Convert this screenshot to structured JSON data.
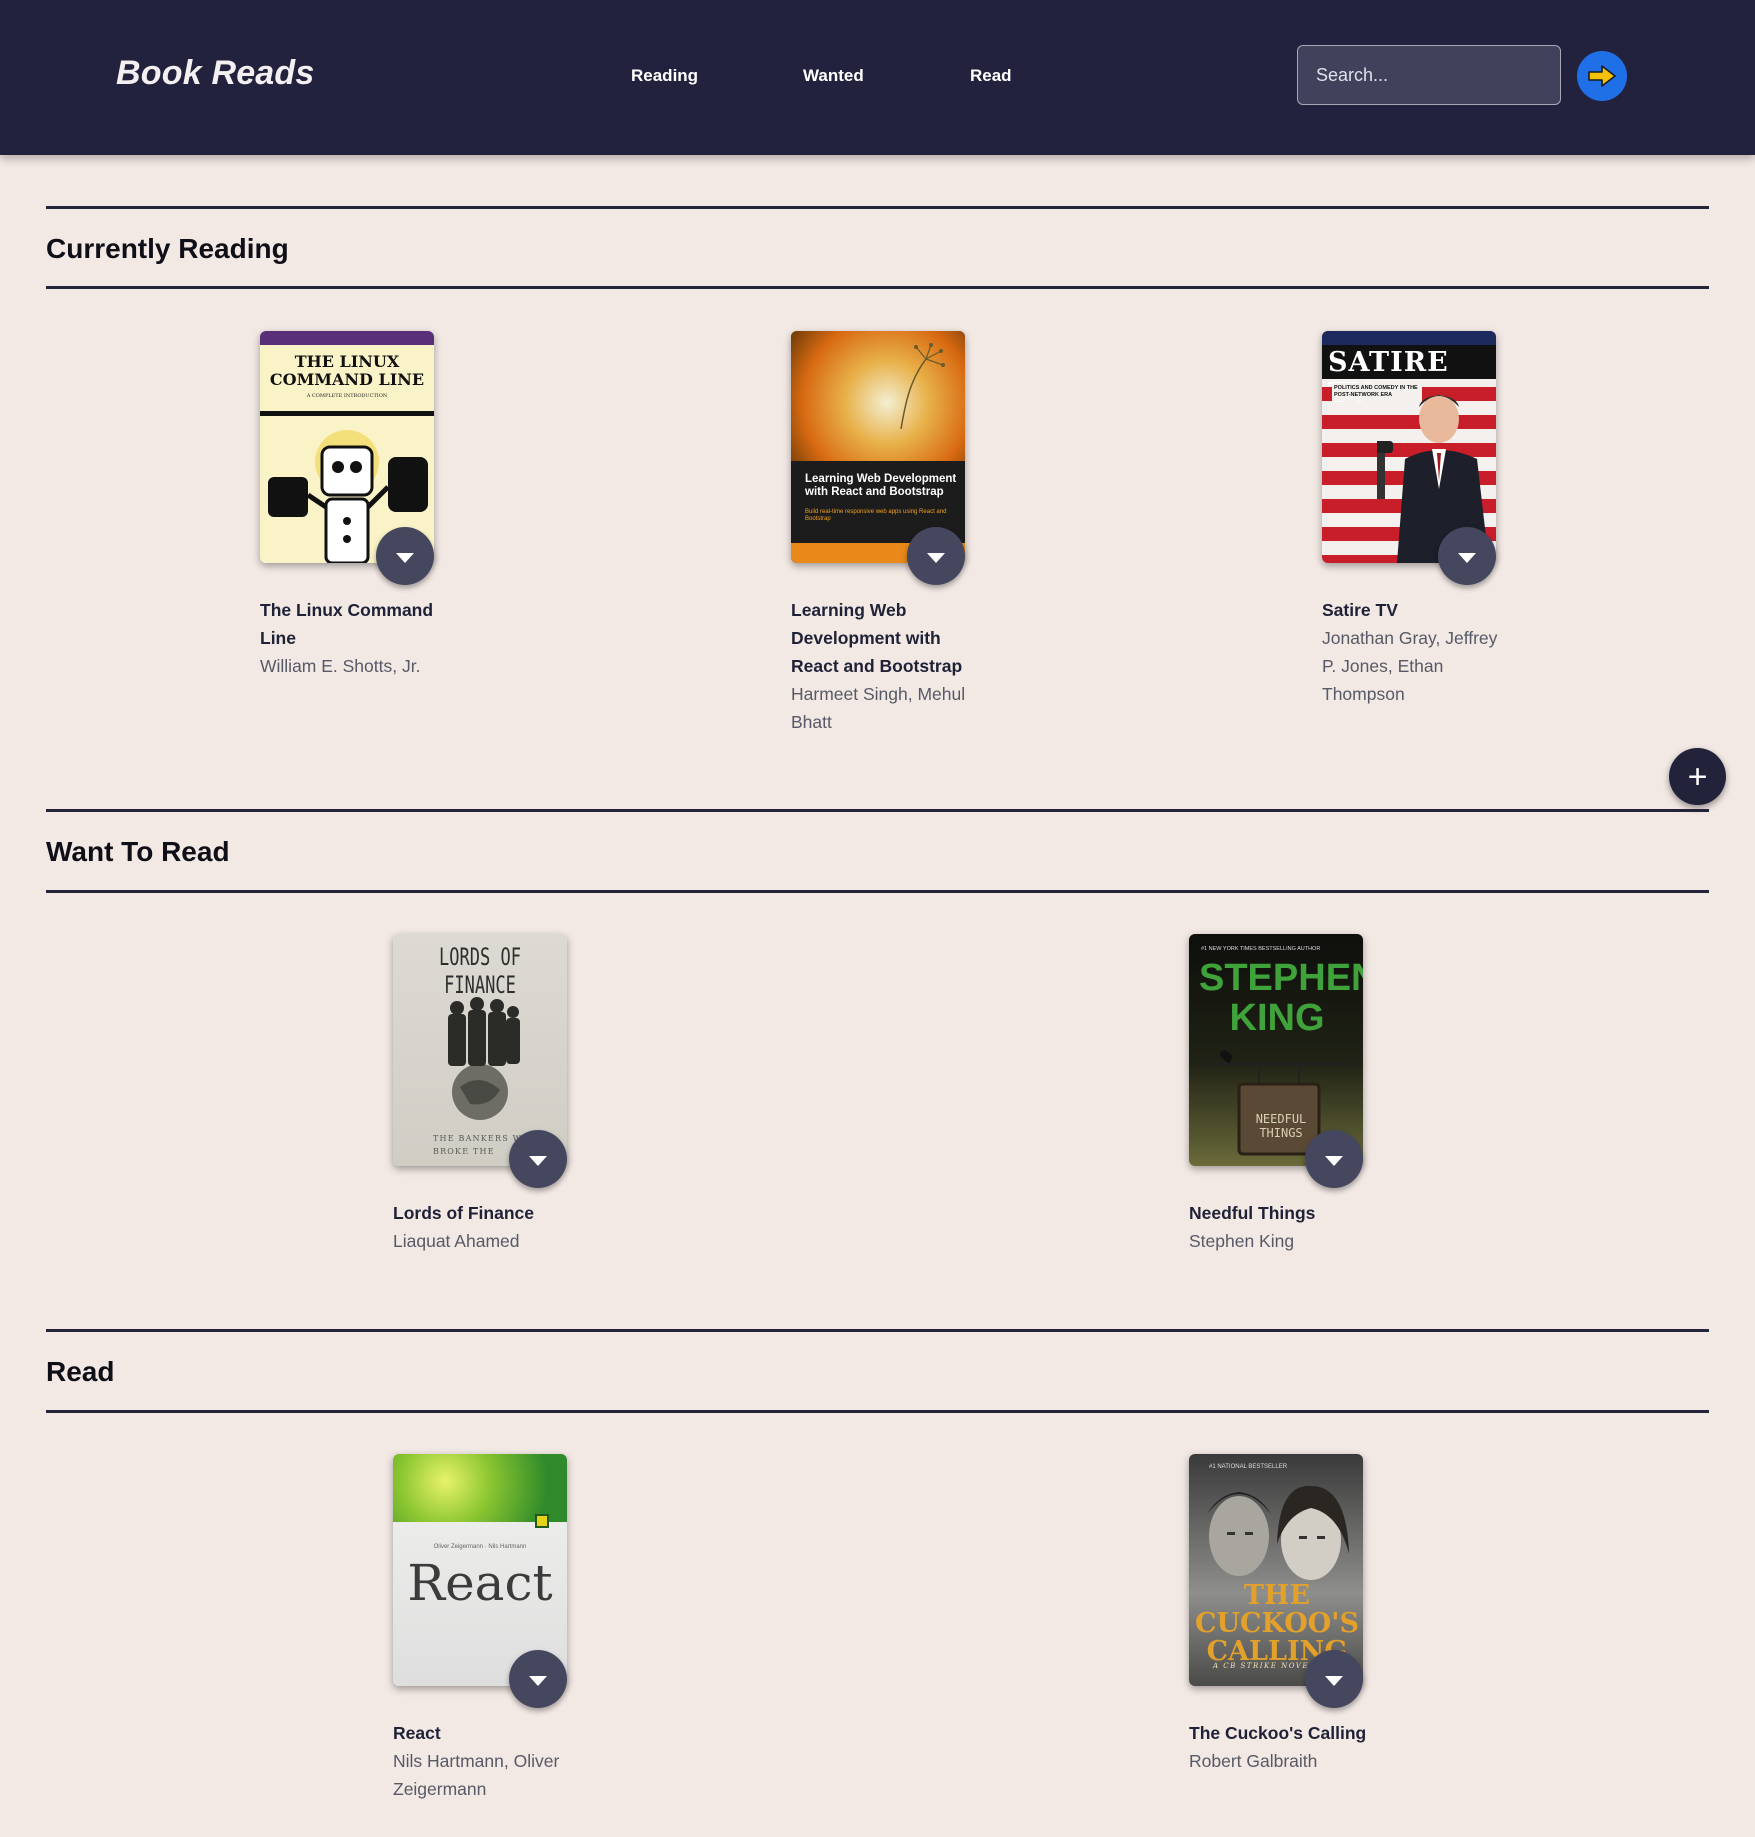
{
  "header": {
    "brand": "Book Reads",
    "nav": [
      "Reading",
      "Wanted",
      "Read"
    ],
    "search_placeholder": "Search..."
  },
  "sections": [
    {
      "title": "Currently Reading",
      "books": [
        {
          "title": "The Linux Command Line",
          "authors": "William E. Shotts, Jr.",
          "cover_text": "THE LINUX COMMAND LINE",
          "cover_sub": "A COMPLETE INTRODUCTION"
        },
        {
          "title": "Learning Web Development with React and Bootstrap",
          "authors": "Harmeet Singh, Mehul Bhatt",
          "cover_text": "Learning Web Development with React and Bootstrap",
          "cover_sub": "Build real-time responsive web apps using React and Bootstrap"
        },
        {
          "title": "Satire TV",
          "authors": "Jonathan Gray, Jeffrey P. Jones, Ethan Thompson",
          "cover_text": "SATIRE TV",
          "cover_sub": "POLITICS AND COMEDY IN THE POST-NETWORK ERA"
        }
      ]
    },
    {
      "title": "Want To Read",
      "books": [
        {
          "title": "Lords of Finance",
          "authors": "Liaquat Ahamed",
          "cover_text": "LORDS OF FINANCE",
          "cover_sub": "THE BANKERS WHO BROKE THE"
        },
        {
          "title": "Needful Things",
          "authors": "Stephen King",
          "cover_text": "STEPHEN KING",
          "cover_sub": "NEEDFUL THINGS",
          "cover_top": "#1 NEW YORK TIMES BESTSELLING AUTHOR"
        }
      ]
    },
    {
      "title": "Read",
      "books": [
        {
          "title": "React",
          "authors": "Nils Hartmann, Oliver Zeigermann",
          "cover_text": "React",
          "cover_sub": "Oliver Zeigermann · Nils Hartmann"
        },
        {
          "title": "The Cuckoo's Calling",
          "authors": "Robert Galbraith",
          "cover_text": "THE CUCKOO'S CALLING",
          "cover_sub": "A CB STRIKE NOVEL",
          "cover_top": "#1 NATIONAL BESTSELLER"
        }
      ]
    }
  ],
  "fab_label": "+",
  "icons": {
    "go": "arrow-right-icon",
    "shelf": "caret-down-icon",
    "add": "plus-icon"
  },
  "colors": {
    "header_bg": "#22223e",
    "page_bg": "#f2e8e4",
    "go_button": "#1f6fe6",
    "go_arrow": "#f4c20d",
    "shelf_button": "#45475f"
  }
}
